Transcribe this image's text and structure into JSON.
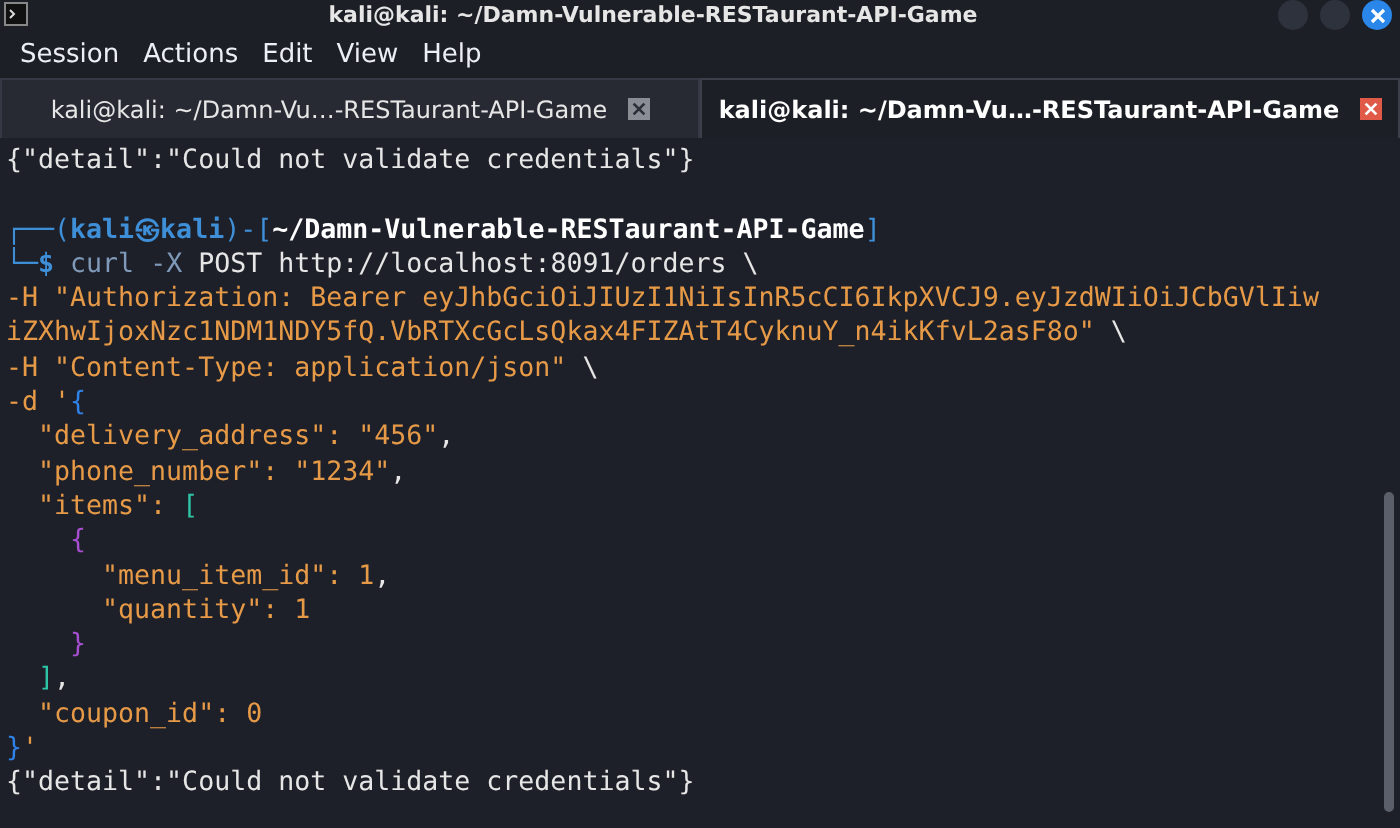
{
  "window": {
    "title": "kali@kali: ~/Damn-Vulnerable-RESTaurant-API-Game"
  },
  "menu": [
    "Session",
    "Actions",
    "Edit",
    "View",
    "Help"
  ],
  "tabs": [
    {
      "label": "kali@kali: ~/Damn-Vu…-RESTaurant-API-Game",
      "selected": false
    },
    {
      "label": "kali@kali: ~/Damn-Vu…-RESTaurant-API-Game",
      "selected": true
    }
  ],
  "terminal": {
    "lines": [
      [
        {
          "kind": "plain",
          "text": "{\"detail\":\"Could not validate credentials\"}"
        }
      ],
      {
        "gap_before": true,
        "segments": [
          {
            "kind": "frame",
            "text": "┌──("
          },
          {
            "kind": "user",
            "text": "kali㉿kali"
          },
          {
            "kind": "frame",
            "text": ")-["
          },
          {
            "kind": "path",
            "text": "~/Damn-Vulnerable-RESTaurant-API-Game"
          },
          {
            "kind": "frame",
            "text": "]"
          }
        ]
      },
      [
        {
          "kind": "frame",
          "text": "└─"
        },
        {
          "kind": "user",
          "text": "$"
        },
        {
          "kind": "cmd",
          "text": " curl -X"
        },
        {
          "kind": "plain",
          "text": " POST http://localhost:8091/orders \\"
        }
      ],
      [
        {
          "kind": "str",
          "text": "-H \"Authorization: Bearer eyJhbGciOiJIUzI1NiIsInR5cCI6IkpXVCJ9.eyJzdWIiOiJCbGVlIiw"
        }
      ],
      [
        {
          "kind": "str",
          "text": "iZXhwIjoxNzc1NDM1NDY5fQ.VbRTXcGcLsQkax4FIZAtT4CyknuY_n4ikKfvL2asF8o\""
        },
        {
          "kind": "plain",
          "text": " \\"
        }
      ],
      [
        {
          "kind": "str",
          "text": "-H \"Content-Type: application/json\""
        },
        {
          "kind": "plain",
          "text": " \\"
        }
      ],
      [
        {
          "kind": "str",
          "text": "-d '"
        },
        {
          "kind": "curly",
          "text": "{"
        }
      ],
      [
        {
          "kind": "str",
          "text": "  \"delivery_address\": \"456\""
        },
        {
          "kind": "plain",
          "text": ","
        }
      ],
      [
        {
          "kind": "str",
          "text": "  \"phone_number\": \"1234\""
        },
        {
          "kind": "plain",
          "text": ","
        }
      ],
      [
        {
          "kind": "str",
          "text": "  \"items\": "
        },
        {
          "kind": "bracket",
          "text": "["
        }
      ],
      [
        {
          "kind": "brace",
          "text": "    {"
        }
      ],
      [
        {
          "kind": "str",
          "text": "      \"menu_item_id\": 1"
        },
        {
          "kind": "plain",
          "text": ","
        }
      ],
      [
        {
          "kind": "str",
          "text": "      \"quantity\": 1"
        }
      ],
      [
        {
          "kind": "brace",
          "text": "    }"
        }
      ],
      [
        {
          "kind": "bracket",
          "text": "  ]"
        },
        {
          "kind": "plain",
          "text": ","
        }
      ],
      [
        {
          "kind": "str",
          "text": "  \"coupon_id\": 0"
        }
      ],
      [
        {
          "kind": "curly",
          "text": "}"
        },
        {
          "kind": "str",
          "text": "'"
        }
      ],
      [
        {
          "kind": "plain",
          "text": "{\"detail\":\"Could not validate credentials\"}"
        }
      ]
    ]
  }
}
